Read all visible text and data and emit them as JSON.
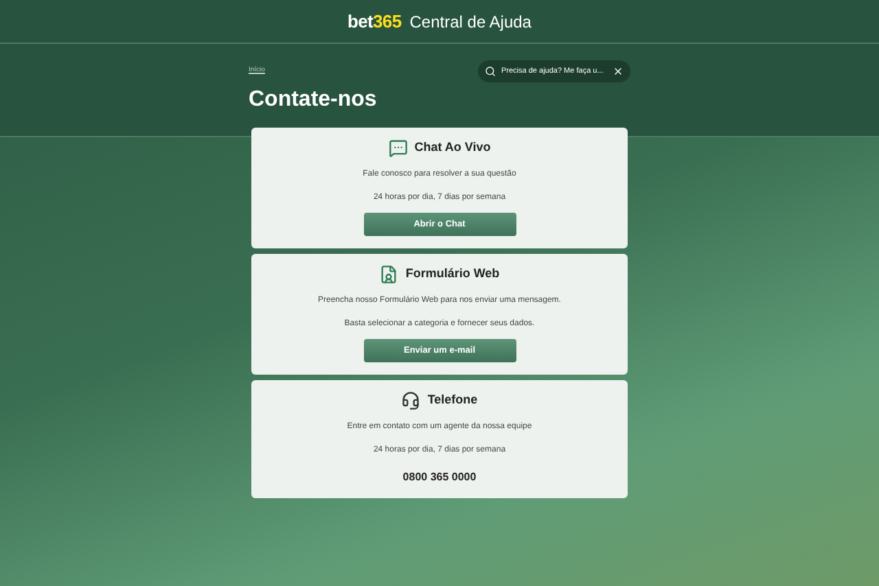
{
  "header": {
    "logo_main": "bet",
    "logo_accent": "365",
    "title": "Central de Ajuda"
  },
  "breadcrumb": "Início",
  "search": {
    "value": "Precisa de ajuda? Me faça u..."
  },
  "page_title": "Contate-nos",
  "cards": [
    {
      "kind": "chat",
      "title": "Chat Ao Vivo",
      "lines": [
        "Fale conosco para resolver a sua questão",
        "24 horas por dia, 7 dias por semana"
      ],
      "button": "Abrir o Chat"
    },
    {
      "kind": "form",
      "title": "Formulário Web",
      "lines": [
        "Preencha nosso Formulário Web para nos enviar uma mensagem.",
        "Basta selecionar a categoria e fornecer seus dados."
      ],
      "button": "Enviar um e-mail"
    },
    {
      "kind": "phone",
      "title": "Telefone",
      "lines": [
        "Entre em contato com um agente da nossa equipe",
        "24 horas por dia, 7 dias por semana"
      ],
      "phone": "0800 365 0000"
    }
  ]
}
